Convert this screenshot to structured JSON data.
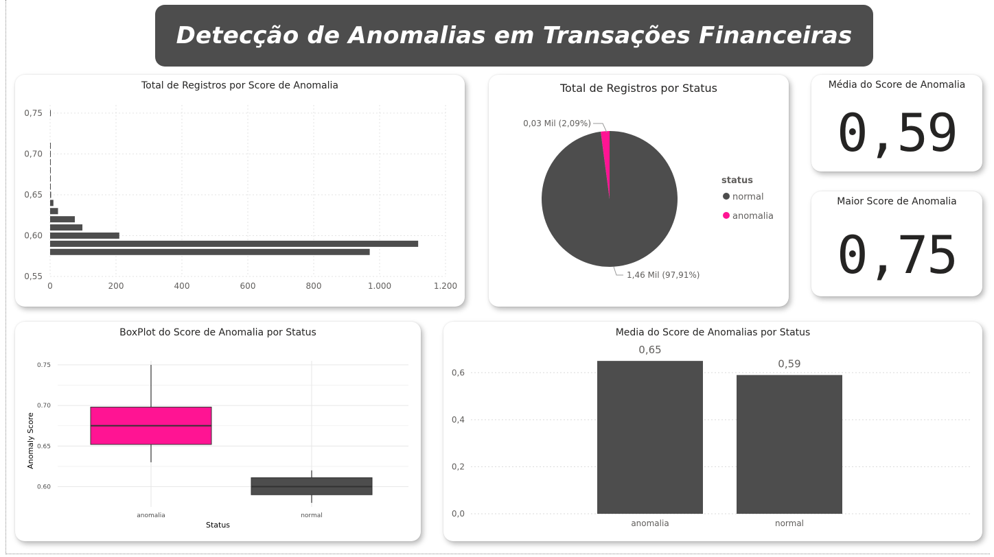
{
  "title": "Detecção de Anomalias em Transações Financeiras",
  "colors": {
    "normal": "#4d4d4d",
    "anomalia": "#ff1493",
    "title_bg": "#4d4d4d"
  },
  "kpis": {
    "avg": {
      "label": "Média do Score de Anomalia",
      "value": "0,59"
    },
    "max": {
      "label": "Maior Score de Anomalia",
      "value": "0,75"
    }
  },
  "chart_data": [
    {
      "id": "histogram",
      "type": "bar",
      "orientation": "horizontal",
      "title": "Total de Registros por Score de Anomalia",
      "xlim": [
        0,
        1200
      ],
      "ylim": [
        0.55,
        0.76
      ],
      "x_ticks": [
        "0",
        "200",
        "400",
        "800",
        "1.000",
        "1.200",
        "600"
      ],
      "x_tick_values": [
        0,
        200,
        400,
        800,
        1000,
        1200,
        600
      ],
      "y_ticks": [
        "0,75",
        "0,70",
        "0,65",
        "0,60",
        "0,55"
      ],
      "y_tick_values": [
        0.75,
        0.7,
        0.65,
        0.6,
        0.55
      ],
      "grid": true,
      "bins": [
        {
          "y": 0.58,
          "count": 970
        },
        {
          "y": 0.59,
          "count": 1117
        },
        {
          "y": 0.6,
          "count": 210
        },
        {
          "y": 0.61,
          "count": 98
        },
        {
          "y": 0.62,
          "count": 75
        },
        {
          "y": 0.63,
          "count": 24
        },
        {
          "y": 0.64,
          "count": 10
        },
        {
          "y": 0.65,
          "count": 3
        },
        {
          "y": 0.66,
          "count": 2
        },
        {
          "y": 0.67,
          "count": 2
        },
        {
          "y": 0.68,
          "count": 2
        },
        {
          "y": 0.69,
          "count": 2
        },
        {
          "y": 0.7,
          "count": 2
        },
        {
          "y": 0.71,
          "count": 2
        },
        {
          "y": 0.75,
          "count": 2
        }
      ]
    },
    {
      "id": "pie",
      "type": "pie",
      "title": "Total de Registros por Status",
      "legend_title": "status",
      "legend_position": "right",
      "slices": [
        {
          "label": "normal",
          "value": 97.91,
          "data_label": "1,46 Mil (97,91%)",
          "color": "#4d4d4d"
        },
        {
          "label": "anomalia",
          "value": 2.09,
          "data_label": "0,03 Mil (2,09%)",
          "color": "#ff1493"
        }
      ]
    },
    {
      "id": "boxplot",
      "type": "boxplot",
      "title": "BoxPlot do Score de Anomalia por Status",
      "xlabel": "Status",
      "ylabel": "Anomaly Score",
      "ylim": [
        0.575,
        0.755
      ],
      "y_ticks": [
        "0.75",
        "0.70",
        "0.65",
        "0.60"
      ],
      "y_tick_values": [
        0.75,
        0.7,
        0.65,
        0.6
      ],
      "groups": [
        {
          "label": "anomalia",
          "min": 0.63,
          "q1": 0.652,
          "median": 0.675,
          "q3": 0.698,
          "max": 0.75,
          "color": "#ff1493"
        },
        {
          "label": "normal",
          "min": 0.58,
          "q1": 0.59,
          "median": 0.6,
          "q3": 0.611,
          "max": 0.62,
          "color": "#4d4d4d"
        }
      ]
    },
    {
      "id": "bars",
      "type": "bar",
      "title": "Media do Score de Anomalias por Status",
      "categories": [
        "anomalia",
        "normal"
      ],
      "values": [
        0.65,
        0.59
      ],
      "data_labels": [
        "0,65",
        "0,59"
      ],
      "ylim": [
        0,
        0.7
      ],
      "y_ticks": [
        "0,6",
        "0,4",
        "0,2",
        "0,0"
      ],
      "y_tick_values": [
        0.6,
        0.4,
        0.2,
        0.0
      ],
      "grid": true
    }
  ]
}
